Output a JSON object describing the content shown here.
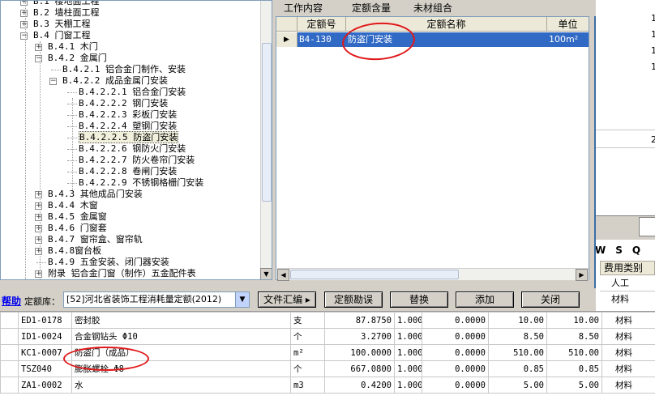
{
  "tree": {
    "items": [
      {
        "label": "B.1 楼地面工程",
        "level": 1,
        "box": "+"
      },
      {
        "label": "B.2 墙柱面工程",
        "level": 1,
        "box": "+"
      },
      {
        "label": "B.3 天棚工程",
        "level": 1,
        "box": "+"
      },
      {
        "label": "B.4 门窗工程",
        "level": 1,
        "box": "-"
      },
      {
        "label": "B.4.1 木门",
        "level": 2,
        "box": "+"
      },
      {
        "label": "B.4.2 金属门",
        "level": 2,
        "box": "-"
      },
      {
        "label": "B.4.2.1 铝合金门制作、安装",
        "level": 3,
        "box": ""
      },
      {
        "label": "B.4.2.2 成品金属门安装",
        "level": 3,
        "box": "-"
      },
      {
        "label": "B.4.2.2.1 铝合金门安装",
        "level": 4,
        "box": ""
      },
      {
        "label": "B.4.2.2.2 钢门安装",
        "level": 4,
        "box": ""
      },
      {
        "label": "B.4.2.2.3 彩板门安装",
        "level": 4,
        "box": ""
      },
      {
        "label": "B.4.2.2.4 塑钢门安装",
        "level": 4,
        "box": ""
      },
      {
        "label": "B.4.2.2.5 防盗门安装",
        "level": 4,
        "box": "",
        "selected": true
      },
      {
        "label": "B.4.2.2.6 钢防火门安装",
        "level": 4,
        "box": ""
      },
      {
        "label": "B.4.2.2.7 防火卷帘门安装",
        "level": 4,
        "box": ""
      },
      {
        "label": "B.4.2.2.8 卷闸门安装",
        "level": 4,
        "box": ""
      },
      {
        "label": "B.4.2.2.9 不锈钢格栅门安装",
        "level": 4,
        "box": ""
      },
      {
        "label": "B.4.3 其他成品门安装",
        "level": 2,
        "box": "+"
      },
      {
        "label": "B.4.4 木窗",
        "level": 2,
        "box": "+"
      },
      {
        "label": "B.4.5 金属窗",
        "level": 2,
        "box": "+"
      },
      {
        "label": "B.4.6 门窗套",
        "level": 2,
        "box": "+"
      },
      {
        "label": "B.4.7 窗帘盒、窗帘轨",
        "level": 2,
        "box": "+"
      },
      {
        "label": "B.4.8窗台板",
        "level": 2,
        "box": "+"
      },
      {
        "label": "B.4.9 五金安装、闭门器安装",
        "level": 2,
        "box": ""
      },
      {
        "label": "附录 铝合金门窗（制作）五金配件表",
        "level": 2,
        "box": "+"
      }
    ]
  },
  "tabs": [
    "工作内容",
    "定额含量",
    "未材组合"
  ],
  "quota_table": {
    "headers": [
      "定额号",
      "定额名称",
      "单位"
    ],
    "rows": [
      {
        "code": "B4-130",
        "name": "防盗门安装",
        "unit": "100m²"
      }
    ]
  },
  "bottom_bar": {
    "help_label": "帮助",
    "library_label": "定额库：",
    "library_value": "[52]河北省装饰工程消耗量定额(2012)",
    "buttons": [
      "文件汇编 ▸",
      "定额勘误",
      "替换",
      "添加",
      "关闭"
    ]
  },
  "background": {
    "right_numbers": [
      "1",
      "1",
      "1",
      "1"
    ],
    "right_value": "2",
    "letters": [
      "W",
      "S",
      "Q"
    ],
    "fee_header": "费用类别",
    "fee_values": [
      "人工",
      "材料"
    ],
    "rows": [
      {
        "code": "ED1-0178",
        "name": "密封胶",
        "unit": "支",
        "v1": "87.8750",
        "v2": "1.000",
        "v3": "0.0000",
        "v4": "10.00",
        "v5": "10.00",
        "type": "材料"
      },
      {
        "code": "ID1-0024",
        "name": "合金钢钻头 Φ10",
        "unit": "个",
        "v1": "3.2700",
        "v2": "1.000",
        "v3": "0.0000",
        "v4": "8.50",
        "v5": "8.50",
        "type": "材料"
      },
      {
        "code": "KC1-0007",
        "name": "防盗门（成品）",
        "unit": "m²",
        "v1": "100.0000",
        "v2": "1.000",
        "v3": "0.0000",
        "v4": "510.00",
        "v5": "510.00",
        "type": "材料"
      },
      {
        "code": "TSZ040",
        "name": "膨胀螺栓 Φ8",
        "unit": "个",
        "v1": "667.0800",
        "v2": "1.000",
        "v3": "0.0000",
        "v4": "0.85",
        "v5": "0.85",
        "type": "材料"
      },
      {
        "code": "ZA1-0002",
        "name": "水",
        "unit": "m3",
        "v1": "0.4200",
        "v2": "1.000",
        "v3": "0.0000",
        "v4": "5.00",
        "v5": "5.00",
        "type": "材料"
      }
    ]
  }
}
